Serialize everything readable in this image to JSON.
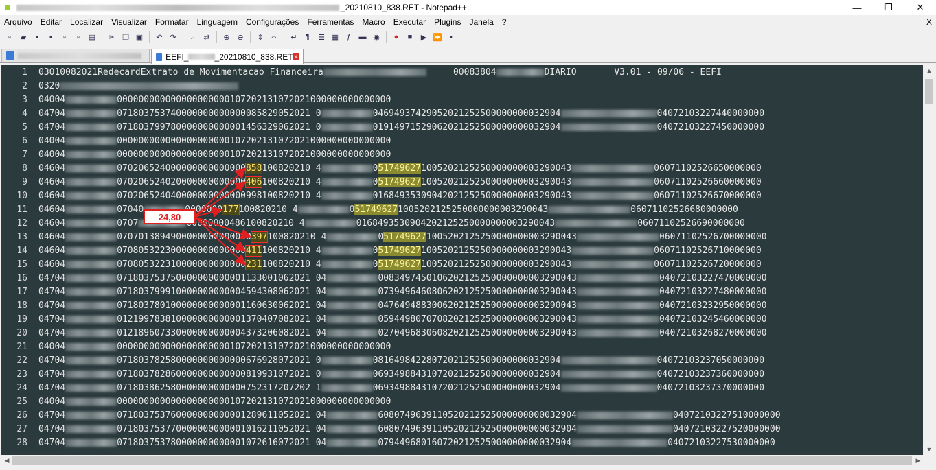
{
  "window": {
    "title": "_20210810_838.RET - Notepad++",
    "minimize": "—",
    "maximize": "❐",
    "close": "✕"
  },
  "menu": {
    "items": [
      "Arquivo",
      "Editar",
      "Localizar",
      "Visualizar",
      "Formatar",
      "Linguagem",
      "Configurações",
      "Ferramentas",
      "Macro",
      "Executar",
      "Plugins",
      "Janela",
      "?"
    ],
    "close": "X"
  },
  "tabs": {
    "active_prefix": "EEFI_",
    "active_suffix": "_20210810_838.RET",
    "close_glyph": "x"
  },
  "callout": {
    "label": "24,80"
  },
  "lines": [
    {
      "n": "1",
      "segs": [
        {
          "t": "03010082021RedecardExtrato de Movimentacao Financeira"
        },
        {
          "b": 150
        },
        {
          "t": "     00083804"
        },
        {
          "b": 70
        },
        {
          "t": "DIARIO       V3.01 - 09/06 - EEFI"
        }
      ]
    },
    {
      "n": "2",
      "segs": [
        {
          "t": "0320"
        },
        {
          "b": 260
        }
      ]
    },
    {
      "n": "3",
      "segs": [
        {
          "t": "04004"
        },
        {
          "b": 75
        },
        {
          "t": "000000000000000000000107202131072021000000000000000"
        }
      ]
    },
    {
      "n": "4",
      "segs": [
        {
          "t": "04704"
        },
        {
          "b": 75
        },
        {
          "t": "071803753740000000000000085829052021 0"
        },
        {
          "b": 75
        },
        {
          "t": "04694937429052021252500000000032904"
        },
        {
          "b": 140
        },
        {
          "t": "04072103227440000000"
        }
      ]
    },
    {
      "n": "5",
      "segs": [
        {
          "t": "04704"
        },
        {
          "b": 75
        },
        {
          "t": "071803799780000000000001456329062021 0"
        },
        {
          "b": 75
        },
        {
          "t": "01914971529062021252500000000032904"
        },
        {
          "b": 140
        },
        {
          "t": "04072103227450000000"
        }
      ]
    },
    {
      "n": "6",
      "segs": [
        {
          "t": "04004"
        },
        {
          "b": 75
        },
        {
          "t": "000000000000000000000107202131072021000000000000000"
        }
      ]
    },
    {
      "n": "7",
      "segs": [
        {
          "t": "04004"
        },
        {
          "b": 75
        },
        {
          "t": "000000000000000000000107202131072021000000000000000"
        }
      ]
    },
    {
      "n": "8",
      "segs": [
        {
          "t": "04604"
        },
        {
          "b": 75
        },
        {
          "t": "070206524000000000000000"
        },
        {
          "r": "858"
        },
        {
          "t": "100820210 4"
        },
        {
          "b": 75
        },
        {
          "t": "0"
        },
        {
          "y": "51749627"
        },
        {
          "t": "1005202125250000000003290043"
        },
        {
          "b": 120
        },
        {
          "t": "06071102526650000000"
        }
      ]
    },
    {
      "n": "9",
      "segs": [
        {
          "t": "04604"
        },
        {
          "b": 75
        },
        {
          "t": "070206524020000000000000"
        },
        {
          "r": "406"
        },
        {
          "t": "100820210 4"
        },
        {
          "b": 75
        },
        {
          "t": "0"
        },
        {
          "y": "51749627"
        },
        {
          "t": "1005202125250000000003290043"
        },
        {
          "b": 120
        },
        {
          "t": "06071102526660000000"
        }
      ]
    },
    {
      "n": "10",
      "segs": [
        {
          "t": "04604"
        },
        {
          "b": 75
        },
        {
          "t": "070206524040000000000000998100820210 4"
        },
        {
          "b": 75
        },
        {
          "t": "0168493530904202125250000000003290043"
        },
        {
          "b": 120
        },
        {
          "t": "06071102526670000000"
        }
      ]
    },
    {
      "n": "11",
      "segs": [
        {
          "t": "04604"
        },
        {
          "b": 75
        },
        {
          "t": "07040"
        },
        {
          "b": 60
        },
        {
          "t": "0000000"
        },
        {
          "r": "177"
        },
        {
          "t": "100820210 4"
        },
        {
          "b": 75
        },
        {
          "t": "0"
        },
        {
          "y": "51749627"
        },
        {
          "t": "1005202125250000000003290043"
        },
        {
          "b": 120
        },
        {
          "t": "06071102526680000000"
        }
      ]
    },
    {
      "n": "12",
      "segs": [
        {
          "t": "04604"
        },
        {
          "b": 75
        },
        {
          "t": "0707"
        },
        {
          "b": 70
        },
        {
          "t": "00000000486100820210 4"
        },
        {
          "b": 75
        },
        {
          "t": "0168493530904202125250000000003290043"
        },
        {
          "b": 120
        },
        {
          "t": "06071102526690000000"
        }
      ]
    },
    {
      "n": "13",
      "segs": [
        {
          "t": "04604"
        },
        {
          "b": 75
        },
        {
          "t": "0707013894900000000000000"
        },
        {
          "r": "397"
        },
        {
          "t": "100820210 4"
        },
        {
          "b": 75
        },
        {
          "t": "0"
        },
        {
          "y": "51749627"
        },
        {
          "t": "1005202125250000000003290043"
        },
        {
          "b": 120
        },
        {
          "t": "06071102526700000000"
        }
      ]
    },
    {
      "n": "14",
      "segs": [
        {
          "t": "04604"
        },
        {
          "b": 75
        },
        {
          "t": "070805322300000000000000"
        },
        {
          "r": "411"
        },
        {
          "t": "100820210 4"
        },
        {
          "b": 75
        },
        {
          "t": "0"
        },
        {
          "y": "51749627"
        },
        {
          "t": "1005202125250000000003290043"
        },
        {
          "b": 120
        },
        {
          "t": "06071102526710000000"
        }
      ]
    },
    {
      "n": "15",
      "segs": [
        {
          "t": "04604"
        },
        {
          "b": 75
        },
        {
          "t": "070805322310000000000000"
        },
        {
          "r": "231"
        },
        {
          "t": "100820210 4"
        },
        {
          "b": 75
        },
        {
          "t": "0"
        },
        {
          "y": "51749627"
        },
        {
          "t": "1005202125250000000003290043"
        },
        {
          "b": 120
        },
        {
          "t": "06071102526720000000"
        }
      ]
    },
    {
      "n": "16",
      "segs": [
        {
          "t": "04704"
        },
        {
          "b": 75
        },
        {
          "t": "071803753750000000000001133001062021 04"
        },
        {
          "b": 75
        },
        {
          "t": "0083497450106202125250000000003290043"
        },
        {
          "b": 120
        },
        {
          "t": "04072103227470000000"
        }
      ]
    },
    {
      "n": "17",
      "segs": [
        {
          "t": "04704"
        },
        {
          "b": 75
        },
        {
          "t": "071803799910000000000004594308062021 04"
        },
        {
          "b": 75
        },
        {
          "t": "0739496460806202125250000000003290043"
        },
        {
          "b": 120
        },
        {
          "t": "04072103227480000000"
        }
      ]
    },
    {
      "n": "18",
      "segs": [
        {
          "t": "04704"
        },
        {
          "b": 75
        },
        {
          "t": "071803780100000000000001160630062021 04"
        },
        {
          "b": 75
        },
        {
          "t": "0476494883006202125250000000003290043"
        },
        {
          "b": 120
        },
        {
          "t": "04072103232950000000"
        }
      ]
    },
    {
      "n": "19",
      "segs": [
        {
          "t": "04704"
        },
        {
          "b": 75
        },
        {
          "t": "012199783810000000000001370407082021 04"
        },
        {
          "b": 75
        },
        {
          "t": "0594498070708202125250000000003290043"
        },
        {
          "b": 120
        },
        {
          "t": "04072103245460000000"
        }
      ]
    },
    {
      "n": "20",
      "segs": [
        {
          "t": "04704"
        },
        {
          "b": 75
        },
        {
          "t": "012189607330000000000004373206082021 04"
        },
        {
          "b": 75
        },
        {
          "t": "0270496830608202125250000000003290043"
        },
        {
          "b": 120
        },
        {
          "t": "04072103268270000000"
        }
      ]
    },
    {
      "n": "21",
      "segs": [
        {
          "t": "04004"
        },
        {
          "b": 75
        },
        {
          "t": "000000000000000000000107202131072021000000000000000"
        }
      ]
    },
    {
      "n": "22",
      "segs": [
        {
          "t": "04704"
        },
        {
          "b": 75
        },
        {
          "t": "071803782580000000000000676928072021 0"
        },
        {
          "b": 75
        },
        {
          "t": "08164984228072021252500000000032904"
        },
        {
          "b": 140
        },
        {
          "t": "04072103237050000000"
        }
      ]
    },
    {
      "n": "23",
      "segs": [
        {
          "t": "04704"
        },
        {
          "b": 75
        },
        {
          "t": "071803782860000000000000819931072021 0"
        },
        {
          "b": 75
        },
        {
          "t": "06934988431072021252500000000032904"
        },
        {
          "b": 140
        },
        {
          "t": "04072103237360000000"
        }
      ]
    },
    {
      "n": "24",
      "segs": [
        {
          "t": "04704"
        },
        {
          "b": 75
        },
        {
          "t": "071803862580000000000000752317207202 1"
        },
        {
          "b": 75
        },
        {
          "t": "06934988431072021252500000000032904"
        },
        {
          "b": 140
        },
        {
          "t": "04072103237370000000"
        }
      ]
    },
    {
      "n": "25",
      "segs": [
        {
          "t": "04004"
        },
        {
          "b": 75
        },
        {
          "t": "000000000000000000000107202131072021000000000000000"
        }
      ]
    },
    {
      "n": "26",
      "segs": [
        {
          "t": "04704"
        },
        {
          "b": 75
        },
        {
          "t": "071803753760000000000001289611052021 04"
        },
        {
          "b": 75
        },
        {
          "t": "6080749639110520212525000000000032904"
        },
        {
          "b": 140
        },
        {
          "t": "04072103227510000000"
        }
      ]
    },
    {
      "n": "27",
      "segs": [
        {
          "t": "04704"
        },
        {
          "b": 75
        },
        {
          "t": "071803753770000000000001016211052021 04"
        },
        {
          "b": 75
        },
        {
          "t": "6080749639110520212525000000000032904"
        },
        {
          "b": 140
        },
        {
          "t": "04072103227520000000"
        }
      ]
    },
    {
      "n": "28",
      "segs": [
        {
          "t": "04704"
        },
        {
          "b": 75
        },
        {
          "t": "071803753780000000000001072616072021 04"
        },
        {
          "b": 75
        },
        {
          "t": "079449680160720212525000000000032904"
        },
        {
          "b": 140
        },
        {
          "t": "04072103227530000000"
        }
      ]
    }
  ]
}
